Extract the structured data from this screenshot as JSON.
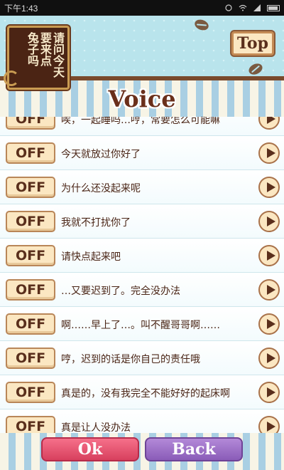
{
  "status_bar": {
    "time": "下午1:43"
  },
  "header": {
    "logo_columns": [
      "请问今天",
      "要来点",
      "兔子吗"
    ],
    "top_label": "Top",
    "title": "Voice"
  },
  "rows": [
    {
      "toggle": "OFF",
      "text": "唉，一起睡吗…哼，常要怎么可能嘛"
    },
    {
      "toggle": "OFF",
      "text": "今天就放过你好了"
    },
    {
      "toggle": "OFF",
      "text": "为什么还没起来呢"
    },
    {
      "toggle": "OFF",
      "text": "我就不打扰你了"
    },
    {
      "toggle": "OFF",
      "text": "请快点起来吧"
    },
    {
      "toggle": "OFF",
      "text": "…又要迟到了。完全没办法"
    },
    {
      "toggle": "OFF",
      "text": "啊……早上了…。叫不醒哥哥啊……"
    },
    {
      "toggle": "OFF",
      "text": "哼，迟到的话是你自己的责任哦"
    },
    {
      "toggle": "OFF",
      "text": "真是的，没有我完全不能好好的起床啊"
    },
    {
      "toggle": "OFF",
      "text": "真是让人没办法"
    }
  ],
  "footer": {
    "ok_label": "Ok",
    "back_label": "Back"
  },
  "colors": {
    "ok": "#e2506d",
    "back": "#9a6cc6",
    "header_bg": "#b9e4ec",
    "title": "#6a2f1a"
  }
}
